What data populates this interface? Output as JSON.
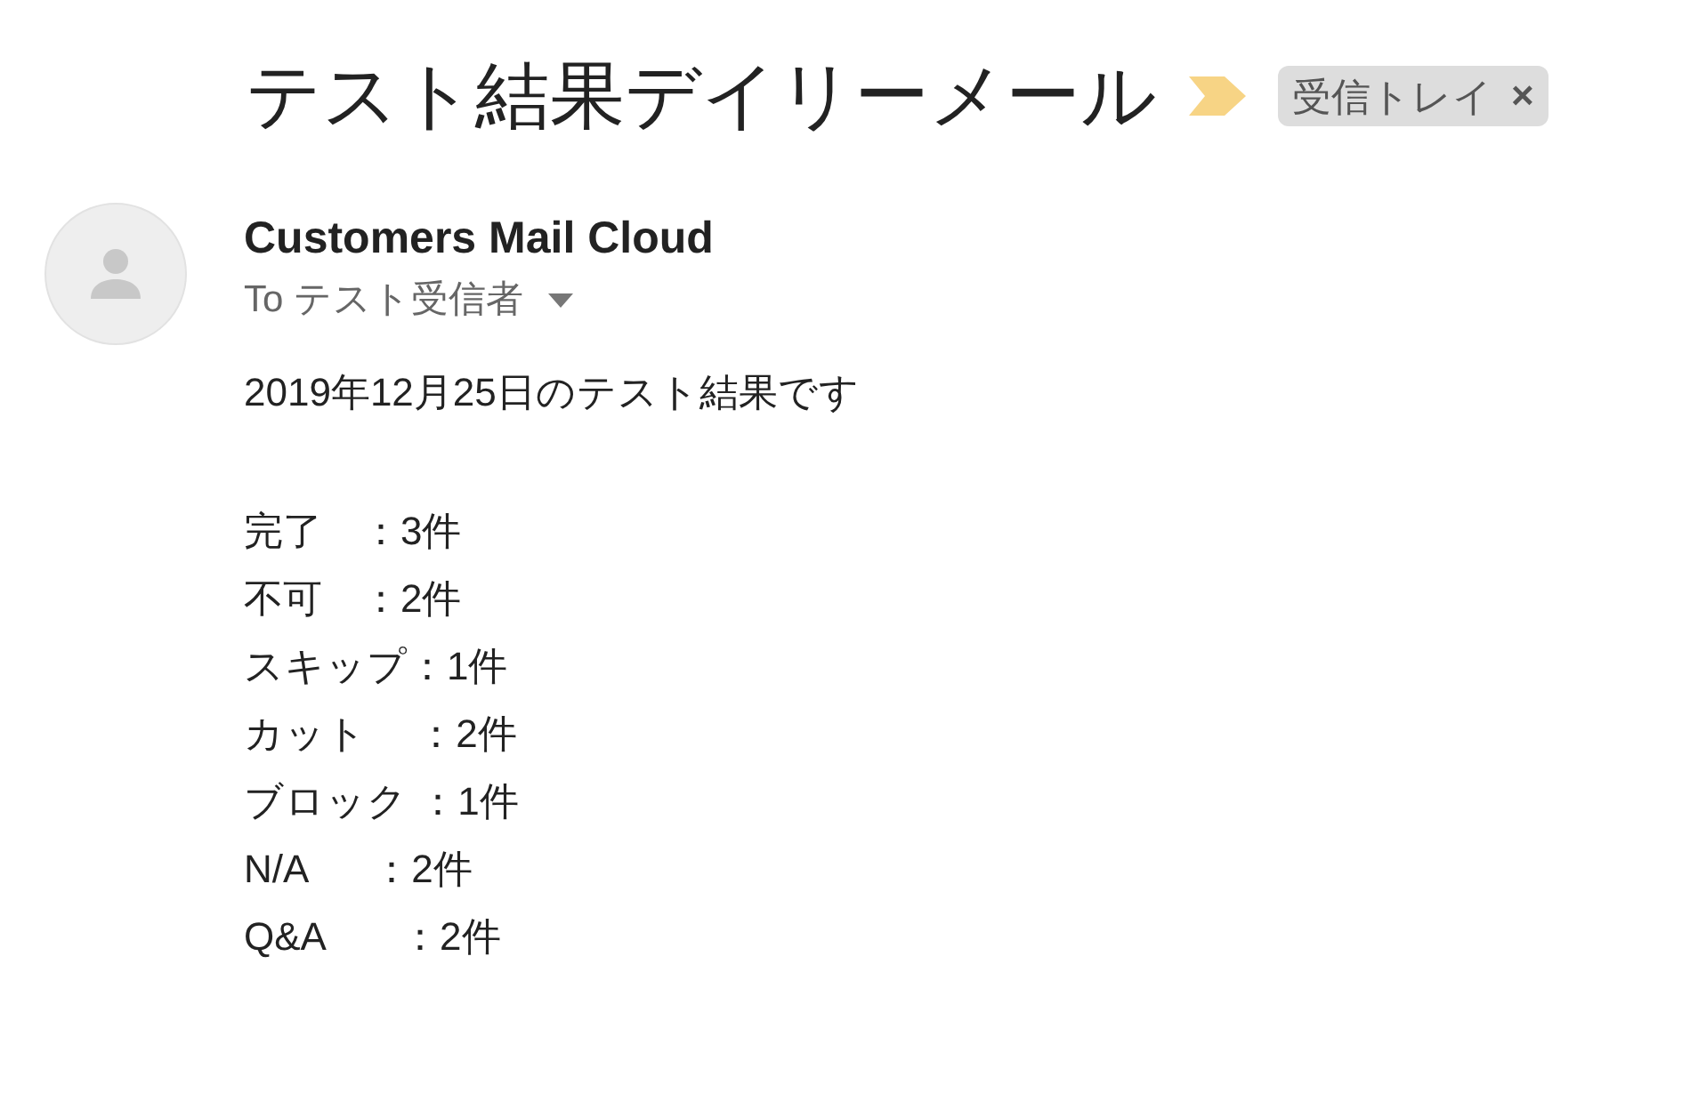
{
  "subject": "テスト結果デイリーメール",
  "important": true,
  "label": {
    "text": "受信トレイ",
    "remove": "×"
  },
  "sender": {
    "name": "Customers Mail Cloud",
    "to": "To テスト受信者"
  },
  "body": {
    "intro": "2019年12月25日のテスト結果です",
    "lines": [
      "完了　：3件",
      "不可　：2件",
      "スキップ：1件",
      "カット　 ：2件",
      "ブロック ：1件",
      "N/A      ：2件",
      "Q&A       ：2件"
    ]
  }
}
